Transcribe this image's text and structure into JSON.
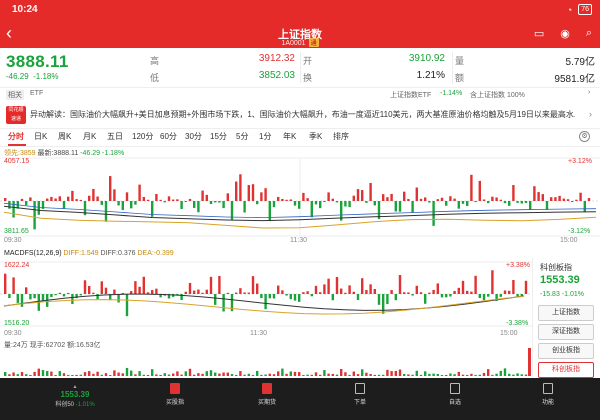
{
  "status": {
    "time": "10:24",
    "battery": "76"
  },
  "header": {
    "title": "上证指数",
    "code": "1A0001",
    "badge": "通"
  },
  "quote": {
    "price": "3888.11",
    "change": "-46.29",
    "change_pct": "-1.18%",
    "high_label": "高",
    "high": "3912.32",
    "open_label": "开",
    "open": "3910.92",
    "vol_label": "量",
    "vol": "5.79亿",
    "low_label": "低",
    "low": "3852.03",
    "turnover_label": "换",
    "turnover": "1.21%",
    "amount_label": "额",
    "amount": "9581.9亿"
  },
  "etf_row": {
    "left_tag": "相关",
    "left_text": "ETF",
    "right_name": "上证指数ETF",
    "right_chg": "-1.14%",
    "right_prem": "含上证指数 100%"
  },
  "news": {
    "badge_top": "同花顺",
    "badge_bottom": "速递",
    "text": "异动解读：国际油价大幅飙升+美日加息预期+外围市场下跌，1、国际油价大幅飙升，布油一度逼近110美元，两大基准原油价格均触及5月19日以来最高水..."
  },
  "tabs": [
    "分时",
    "日K",
    "周K",
    "月K",
    "五日",
    "120分",
    "60分",
    "30分",
    "15分",
    "5分",
    "1分",
    "年K",
    "季K",
    "排序"
  ],
  "chart_top": {
    "legend_a": "领先:3859",
    "legend_b": "最新:3888.11",
    "legend_c": "-46.29",
    "legend_d": "-1.18%",
    "y_top": "4057.15",
    "y_bottom": "3811.65",
    "pct_top": "+3.12%",
    "pct_bottom": "-3.12%",
    "t_start": "09:30",
    "t_mid": "11:30",
    "t_end": "15:00"
  },
  "chart_macd": {
    "legend": "MACDFS(12,26,9)",
    "diff_l": "DIFF:1.549",
    "diff": "DIFF:0.376",
    "dea": "DEA:-0.399",
    "y_top": "1622.24",
    "y_bottom": "1516.20",
    "pct_top": "+3.38%",
    "pct_bottom": "-3.38%",
    "t_start": "09:30",
    "t_mid": "11:30",
    "t_end": "15:00"
  },
  "volume": {
    "label": "量:24万",
    "current": "现手:62702",
    "ratio": "额:16.53亿"
  },
  "right_panel": {
    "title": "科创板指",
    "price": "1553.39",
    "change": "-15.83",
    "change_pct": "-1.01%",
    "buttons": [
      "上证指数",
      "深证指数",
      "创业板指",
      "科创板指"
    ]
  },
  "bottom_nav": {
    "ticker_price": "1553.39",
    "ticker_name": "科创50",
    "ticker_chg": "-1.01%",
    "items": [
      "买股指",
      "买期货",
      "下单",
      "自选",
      "功能"
    ]
  },
  "colors": {
    "up": "#e03232",
    "down": "#1aa33a",
    "brand": "#e52a2a"
  },
  "chart_data": {
    "type": "line",
    "title": "",
    "x": [
      "09:30",
      "11:30",
      "15:00"
    ],
    "ylim": [
      3811.65,
      4057.15
    ],
    "series": [
      {
        "name": "",
        "values": [
          3905,
          3892,
          3886,
          3878,
          3870,
          3866,
          3862,
          3860,
          3863,
          3868,
          3872,
          3876,
          3880,
          3883,
          3885,
          3887,
          3888
        ]
      }
    ]
  }
}
